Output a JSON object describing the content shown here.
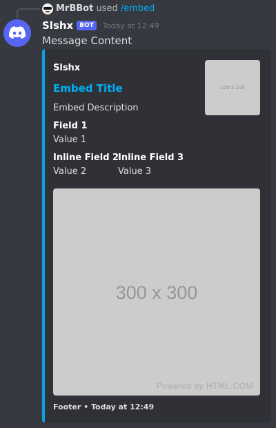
{
  "reply": {
    "user": "MrBBot",
    "used": "used",
    "command": "/embed"
  },
  "message": {
    "username": "Slshx",
    "badge": "BOT",
    "timestamp": "Today at 12:49",
    "content": "Message Content"
  },
  "embed": {
    "accent_color": "#0e9fe6",
    "author": "Slshx",
    "title": "Embed Title",
    "description": "Embed Description",
    "thumbnail_label": "100 x 100",
    "fields": [
      {
        "name": "Field 1",
        "value": "Value 1",
        "inline": false
      },
      {
        "name": "Inline Field 2",
        "value": "Value 2",
        "inline": true
      },
      {
        "name": "Inline Field 3",
        "value": "Value 3",
        "inline": true
      }
    ],
    "image_label": "300 x 300",
    "image_credit": "Powered by HTML.COM",
    "footer": "Footer • Today at 12:49"
  },
  "icons": {
    "avatar": "discord-logo-icon",
    "reply_avatar": "sunglasses-face-icon"
  }
}
